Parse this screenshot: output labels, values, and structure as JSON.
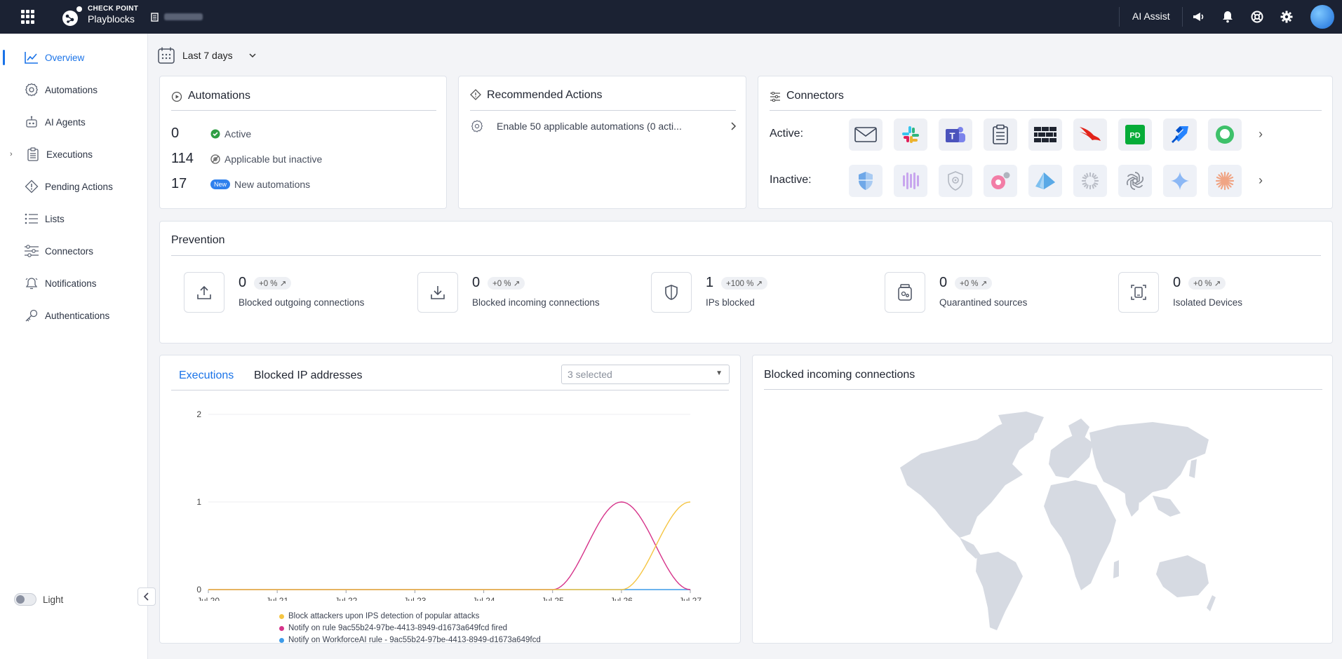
{
  "topbar": {
    "brand_line1": "CHECK POINT",
    "brand_line2": "Playblocks",
    "ai_assist": "AI Assist",
    "icons": [
      "apps-grid-icon",
      "megaphone-icon",
      "bell-icon",
      "help-icon",
      "gear-icon",
      "avatar"
    ]
  },
  "sidebar": {
    "items": [
      {
        "label": "Overview",
        "icon": "chart-icon",
        "active": true
      },
      {
        "label": "Automations",
        "icon": "gear-icon"
      },
      {
        "label": "AI Agents",
        "icon": "robot-icon"
      },
      {
        "label": "Executions",
        "icon": "clipboard-icon",
        "expandable": true
      },
      {
        "label": "Pending Actions",
        "icon": "diamond-icon"
      },
      {
        "label": "Lists",
        "icon": "list-icon"
      },
      {
        "label": "Connectors",
        "icon": "sliders-icon"
      },
      {
        "label": "Notifications",
        "icon": "bell-icon"
      },
      {
        "label": "Authentications",
        "icon": "key-icon"
      }
    ],
    "theme_label": "Light"
  },
  "date_range": {
    "label": "Last 7 days"
  },
  "automations": {
    "title": "Automations",
    "rows": [
      {
        "count": "0",
        "label": "Active",
        "badge": ""
      },
      {
        "count": "114",
        "label": "Applicable but inactive",
        "badge": ""
      },
      {
        "count": "17",
        "label": "New automations",
        "badge": "New"
      }
    ]
  },
  "recommended": {
    "title": "Recommended Actions",
    "items": [
      "Enable 50 applicable automations (0 acti..."
    ]
  },
  "connectors": {
    "title": "Connectors",
    "active_label": "Active:",
    "inactive_label": "Inactive:",
    "active": [
      "mail-icon",
      "slack-icon",
      "teams-icon",
      "clipboard-icon",
      "firewall-icon",
      "crowdstrike-icon",
      "pagerduty-icon",
      "jira-icon",
      "chat-bubble-icon"
    ],
    "inactive": [
      "shield-icon",
      "bars-icon",
      "shield-gear-icon",
      "cluster-icon",
      "azure-icon",
      "sunburst-icon",
      "openai-icon",
      "sparkle-icon",
      "asterisk-icon"
    ],
    "pd_text": "PD",
    "teams_text": "T"
  },
  "prevention": {
    "title": "Prevention",
    "items": [
      {
        "value": "0",
        "change": "+0 % ↗",
        "label": "Blocked outgoing connections",
        "icon": "upload-icon"
      },
      {
        "value": "0",
        "change": "+0 % ↗",
        "label": "Blocked incoming connections",
        "icon": "download-icon"
      },
      {
        "value": "1",
        "change": "+100 % ↗",
        "label": "IPs blocked",
        "icon": "shield-icon"
      },
      {
        "value": "0",
        "change": "+0 % ↗",
        "label": "Quarantined sources",
        "icon": "jar-icon"
      },
      {
        "value": "0",
        "change": "+0 % ↗",
        "label": "Isolated Devices",
        "icon": "device-icon"
      }
    ]
  },
  "executions_panel": {
    "tabs": [
      "Executions",
      "Blocked IP addresses"
    ],
    "select_value": "3 selected"
  },
  "chart_data": {
    "type": "line",
    "x": [
      "Jul 20",
      "Jul 21",
      "Jul 22",
      "Jul 23",
      "Jul 24",
      "Jul 25",
      "Jul 26",
      "Jul 27"
    ],
    "ylim": [
      0,
      2
    ],
    "yticks": [
      "0",
      "1",
      "2"
    ],
    "grid": true,
    "legend_position": "bottom",
    "series": [
      {
        "name": "Block attackers upon IPS detection of popular attacks",
        "color": "#f5c542",
        "values": [
          0,
          0,
          0,
          0,
          0,
          0,
          0,
          1
        ]
      },
      {
        "name": "Notify on rule 9ac55b24-97be-4413-8949-d1673a649fcd fired",
        "color": "#d6338a",
        "values": [
          0,
          0,
          0,
          0,
          0,
          0,
          1,
          0
        ]
      },
      {
        "name": "Notify on WorkforceAI rule - 9ac55b24-97be-4413-8949-d1673a649fcd",
        "color": "#3d9be9",
        "values": [
          0,
          0,
          0,
          0,
          0,
          0,
          0,
          0
        ]
      }
    ]
  },
  "map_panel": {
    "title": "Blocked incoming connections"
  }
}
